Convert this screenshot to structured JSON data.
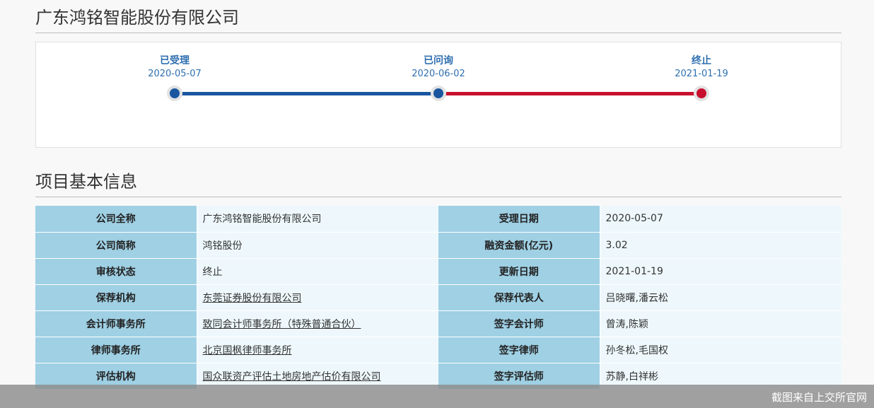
{
  "header": {
    "company_title": "广东鸿铭智能股份有限公司"
  },
  "timeline": {
    "steps": [
      {
        "status": "已受理",
        "date": "2020-05-07"
      },
      {
        "status": "已问询",
        "date": "2020-06-02"
      },
      {
        "status": "终止",
        "date": "2021-01-19"
      }
    ],
    "colors": {
      "done": "#1a56a0",
      "terminated": "#c8102e"
    }
  },
  "info": {
    "title": "项目基本信息",
    "rows": [
      {
        "l1": "公司全称",
        "v1": "广东鸿铭智能股份有限公司",
        "l2": "受理日期",
        "v2": "2020-05-07"
      },
      {
        "l1": "公司简称",
        "v1": "鸿铭股份",
        "l2": "融资金额(亿元)",
        "v2": "3.02"
      },
      {
        "l1": "审核状态",
        "v1": "终止",
        "l2": "更新日期",
        "v2": "2021-01-19"
      },
      {
        "l1": "保荐机构",
        "v1": "东莞证券股份有限公司",
        "l2": "保荐代表人",
        "v2": "吕晓曙,潘云松"
      },
      {
        "l1": "会计师事务所",
        "v1": "致同会计师事务所（特殊普通合伙）",
        "l2": "签字会计师",
        "v2": "曾涛,陈颖"
      },
      {
        "l1": "律师事务所",
        "v1": "北京国枫律师事务所",
        "l2": "签字律师",
        "v2": "孙冬松,毛国权"
      },
      {
        "l1": "评估机构",
        "v1": "国众联资产评估土地房地产估价有限公司",
        "l2": "签字评估师",
        "v2": "苏静,白祥彬"
      }
    ]
  },
  "footer": {
    "caption": "截图来自上交所官网"
  }
}
